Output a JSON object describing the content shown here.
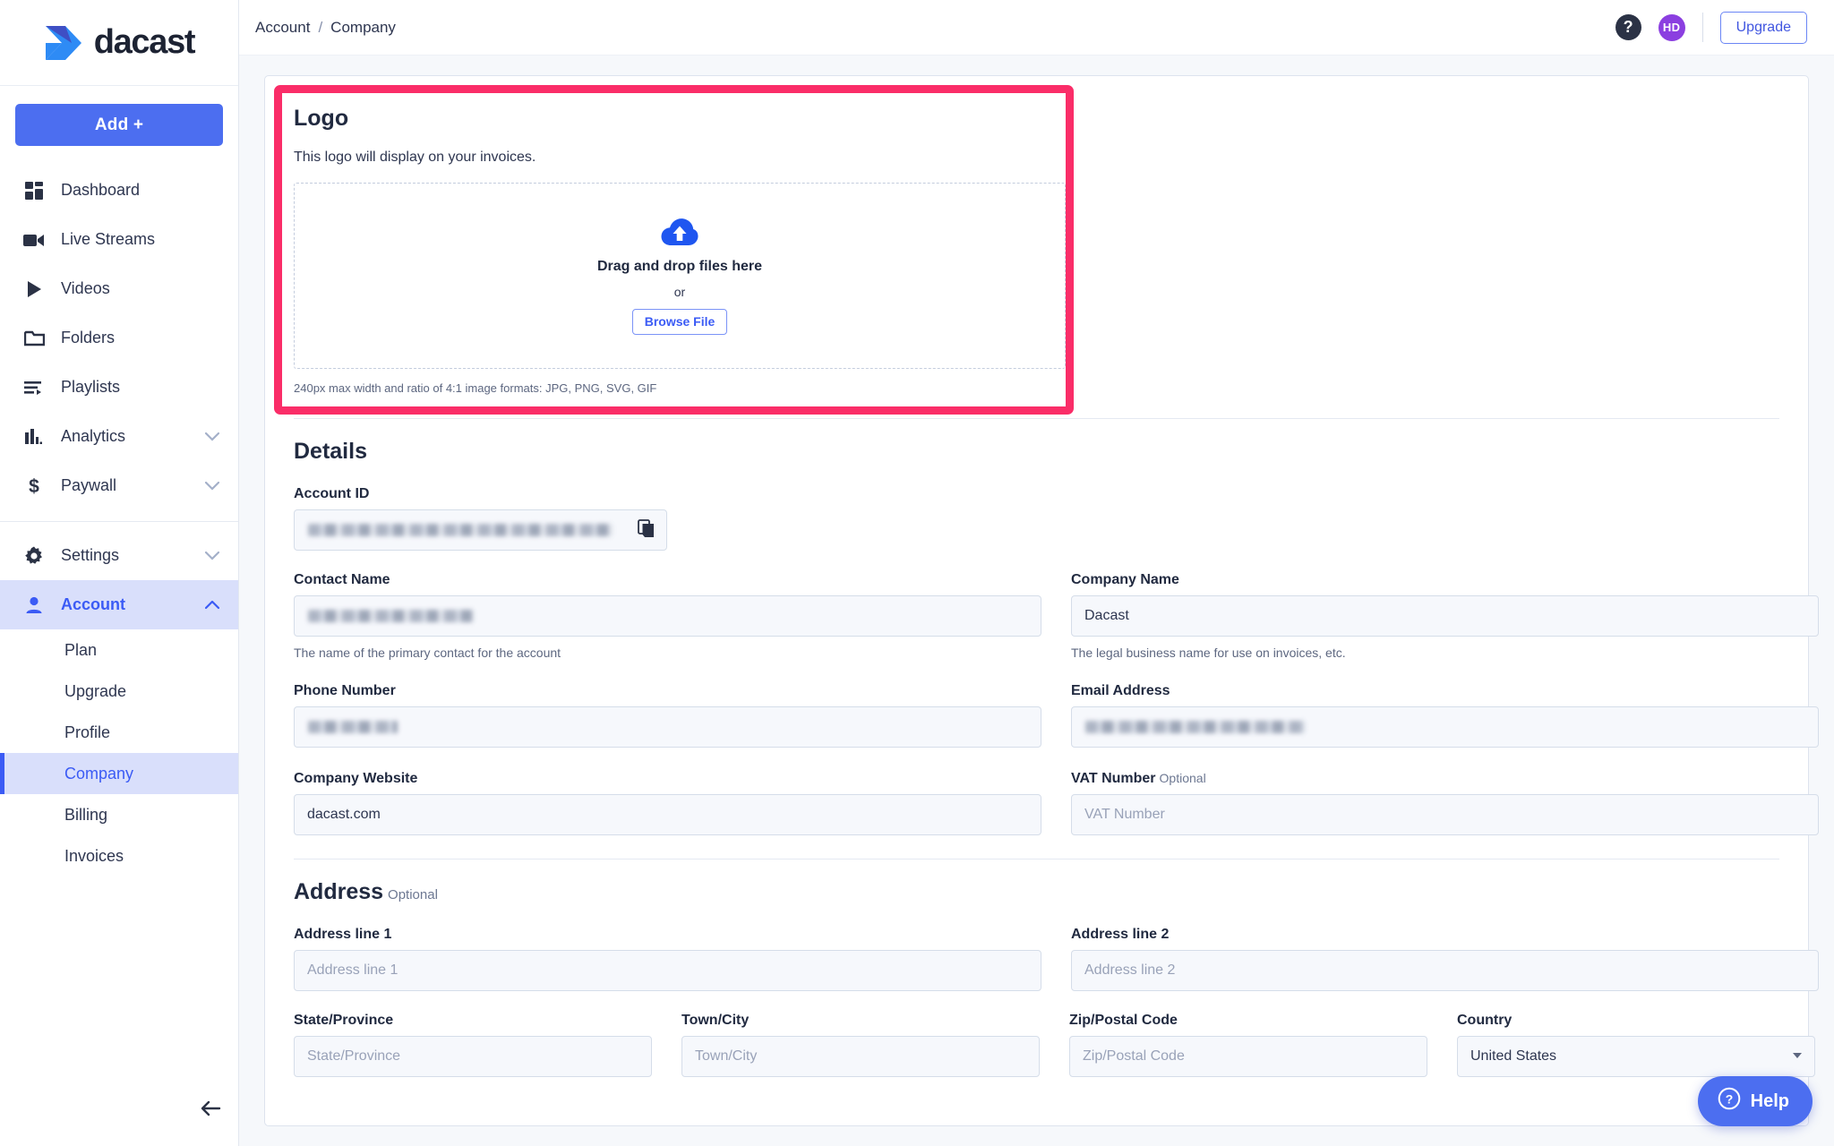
{
  "brand": {
    "name": "dacast",
    "accent_blue": "#4c6ef0",
    "accent_pink": "#fa2d68",
    "logo_dark_blue": "#3f4fc4",
    "logo_light_blue": "#2e8bf5"
  },
  "sidebar": {
    "add_button": "Add +",
    "items": [
      {
        "label": "Dashboard",
        "icon": "dashboard-icon",
        "chevron": null,
        "active": false
      },
      {
        "label": "Live Streams",
        "icon": "video-camera-icon",
        "chevron": null,
        "active": false
      },
      {
        "label": "Videos",
        "icon": "play-icon",
        "chevron": null,
        "active": false
      },
      {
        "label": "Folders",
        "icon": "folder-icon",
        "chevron": null,
        "active": false
      },
      {
        "label": "Playlists",
        "icon": "playlist-icon",
        "chevron": null,
        "active": false
      },
      {
        "label": "Analytics",
        "icon": "bar-chart-icon",
        "chevron": "down",
        "active": false
      },
      {
        "label": "Paywall",
        "icon": "dollar-icon",
        "chevron": "down",
        "active": false
      }
    ],
    "items2": [
      {
        "label": "Settings",
        "icon": "gear-icon",
        "chevron": "down",
        "active": false
      },
      {
        "label": "Account",
        "icon": "person-icon",
        "chevron": "up",
        "active": true
      }
    ],
    "subitems": [
      {
        "label": "Plan",
        "active": false
      },
      {
        "label": "Upgrade",
        "active": false
      },
      {
        "label": "Profile",
        "active": false
      },
      {
        "label": "Company",
        "active": true
      },
      {
        "label": "Billing",
        "active": false
      },
      {
        "label": "Invoices",
        "active": false
      }
    ],
    "collapse_icon": "arrow-left-icon"
  },
  "topbar": {
    "breadcrumb": {
      "parent": "Account",
      "separator": "/",
      "current": "Company"
    },
    "help_icon_label": "?",
    "avatar_initials": "HD",
    "upgrade_label": "Upgrade"
  },
  "logo_section": {
    "title": "Logo",
    "description": "This logo will display on your invoices.",
    "dropzone": {
      "icon": "cloud-upload-icon",
      "primary": "Drag and drop files here",
      "or": "or",
      "browse_label": "Browse File"
    },
    "hint": "240px max width and ratio of 4:1 image formats: JPG, PNG, SVG, GIF",
    "highlighted": true
  },
  "details_section": {
    "title": "Details",
    "account_id": {
      "label": "Account ID",
      "value": "",
      "redacted": true,
      "copy_icon": "copy-icon"
    },
    "fields": [
      {
        "label": "Contact Name",
        "value": "",
        "placeholder": "",
        "hint": "The name of the primary contact for the account",
        "redacted": true,
        "optional": false
      },
      {
        "label": "Company Name",
        "value": "Dacast",
        "placeholder": "",
        "hint": "The legal business name for use on invoices, etc.",
        "redacted": false,
        "optional": false
      },
      {
        "label": "Phone Number",
        "value": "",
        "placeholder": "",
        "hint": "",
        "redacted": true,
        "optional": false
      },
      {
        "label": "Email Address",
        "value": "",
        "placeholder": "",
        "hint": "",
        "redacted": true,
        "optional": false
      },
      {
        "label": "Company Website",
        "value": "dacast.com",
        "placeholder": "",
        "hint": "",
        "redacted": false,
        "optional": false
      },
      {
        "label": "VAT Number",
        "value": "",
        "placeholder": "VAT Number",
        "hint": "",
        "redacted": false,
        "optional": true,
        "optional_label": "Optional"
      }
    ]
  },
  "address_section": {
    "title": "Address",
    "optional_label": "Optional",
    "line1": {
      "label": "Address line 1",
      "value": "",
      "placeholder": "Address line 1"
    },
    "line2": {
      "label": "Address line 2",
      "value": "",
      "placeholder": "Address line 2"
    },
    "state": {
      "label": "State/Province",
      "value": "",
      "placeholder": "State/Province"
    },
    "city": {
      "label": "Town/City",
      "value": "",
      "placeholder": "Town/City"
    },
    "zip": {
      "label": "Zip/Postal Code",
      "value": "",
      "placeholder": "Zip/Postal Code"
    },
    "country": {
      "label": "Country",
      "value": "United States",
      "options": [
        "United States"
      ]
    }
  },
  "help_widget": {
    "label": "Help",
    "icon": "question-circle-icon"
  }
}
